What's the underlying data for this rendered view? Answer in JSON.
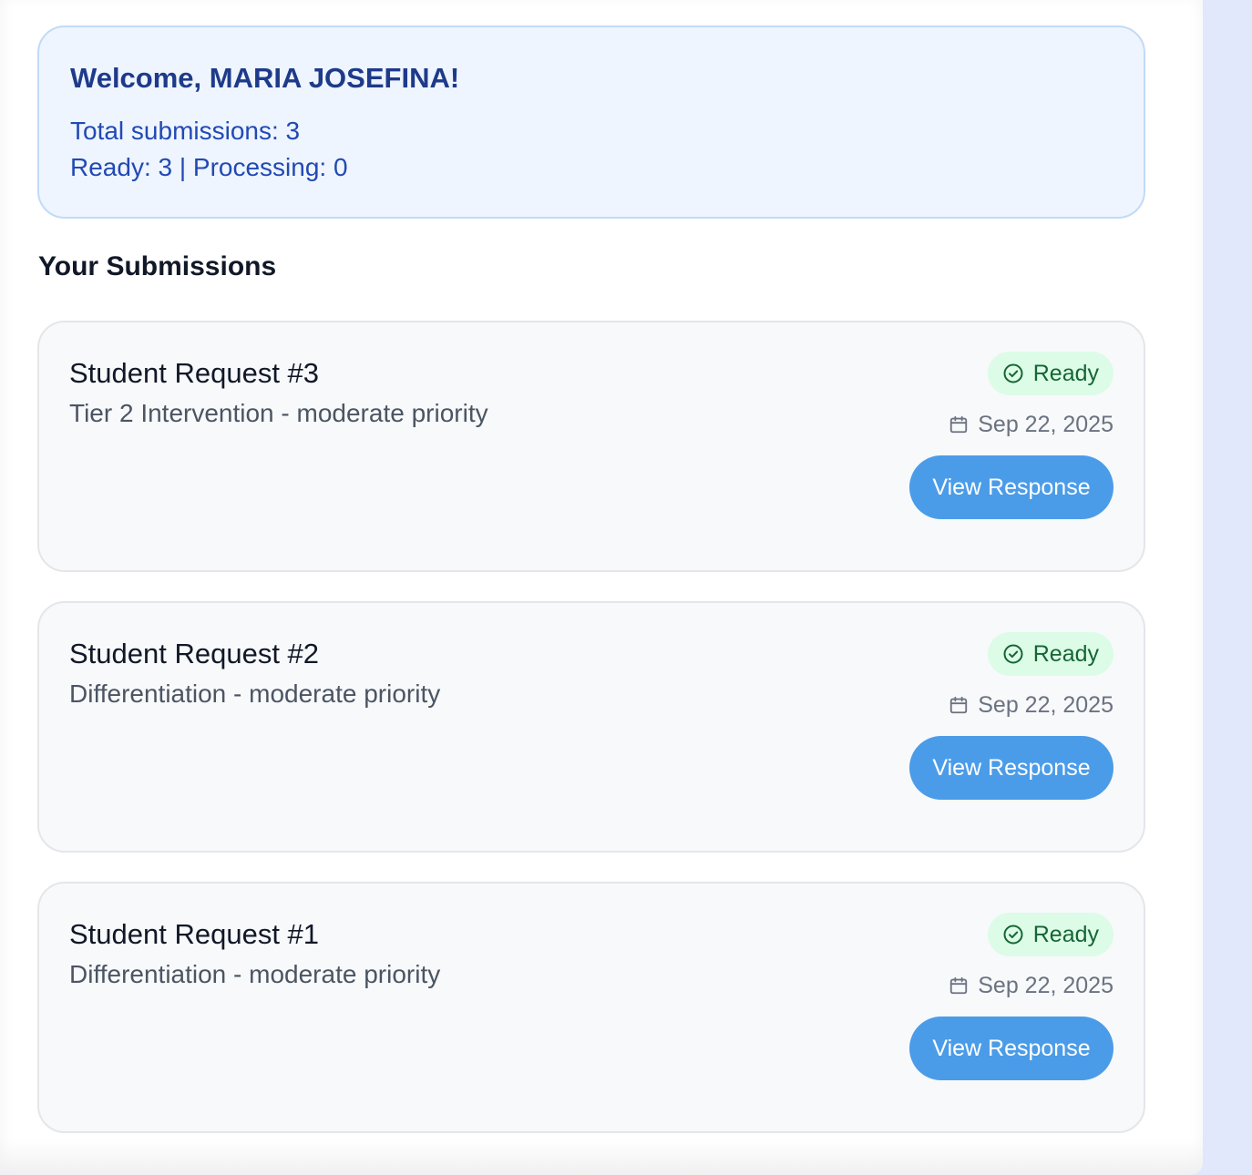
{
  "welcome": {
    "heading": "Welcome, MARIA JOSEFINA!",
    "total_line": "Total submissions: 3",
    "status_line": "Ready: 3 | Processing: 0"
  },
  "section_title": "Your Submissions",
  "submissions": [
    {
      "title": "Student Request #3",
      "subtitle": "Tier 2 Intervention - moderate priority",
      "status": "Ready",
      "status_icon": "check-circle-icon",
      "date": "Sep 22, 2025",
      "date_icon": "calendar-icon",
      "button_label": "View Response"
    },
    {
      "title": "Student Request #2",
      "subtitle": "Differentiation - moderate priority",
      "status": "Ready",
      "status_icon": "check-circle-icon",
      "date": "Sep 22, 2025",
      "date_icon": "calendar-icon",
      "button_label": "View Response"
    },
    {
      "title": "Student Request #1",
      "subtitle": "Differentiation - moderate priority",
      "status": "Ready",
      "status_icon": "check-circle-icon",
      "date": "Sep 22, 2025",
      "date_icon": "calendar-icon",
      "button_label": "View Response"
    }
  ],
  "colors": {
    "welcome_bg": "#eef5fe",
    "welcome_text": "#1e3a8a",
    "ready_badge_bg": "#dcfce7",
    "ready_badge_text": "#166534",
    "button_bg": "#4b9ce8",
    "card_bg": "#f8f9fb"
  }
}
